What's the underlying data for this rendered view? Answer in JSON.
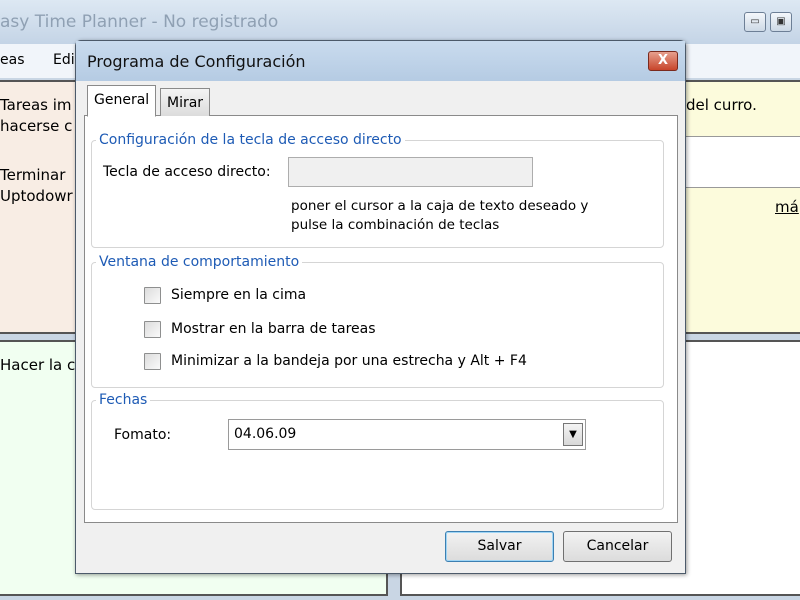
{
  "app": {
    "title": "asy Time Planner - No registrado",
    "menu": [
      "eas",
      "Edi"
    ]
  },
  "background": {
    "top_left": [
      "Tareas im",
      "hacerse c",
      "Terminar",
      "Uptodowr"
    ],
    "top_right": "del curro.",
    "top_right_link": "má",
    "bottom_left": "Hacer la c"
  },
  "dialog": {
    "title": "Programa de Configuración",
    "close_icon": "close-icon",
    "tabs": [
      {
        "label": "General",
        "active": true
      },
      {
        "label": "Mirar",
        "active": false
      }
    ],
    "hotkey_group": {
      "title": "Configuración de la tecla de acceso directo",
      "label": "Tecla de acceso directo:",
      "value": "",
      "hint": [
        "poner el cursor a la caja de texto deseado y",
        "pulse la combinación de teclas"
      ]
    },
    "behavior_group": {
      "title": "Ventana de comportamiento",
      "options": [
        {
          "label": "Siempre en la cima",
          "checked": false
        },
        {
          "label": "Mostrar en la barra de tareas",
          "checked": false
        },
        {
          "label": "Minimizar a la bandeja por una estrecha y Alt + F4",
          "checked": false
        }
      ]
    },
    "dates_group": {
      "title": "Fechas",
      "format_label": "Fomato:",
      "format_value": "04.06.09"
    },
    "save": "Salvar",
    "cancel": "Cancelar"
  }
}
